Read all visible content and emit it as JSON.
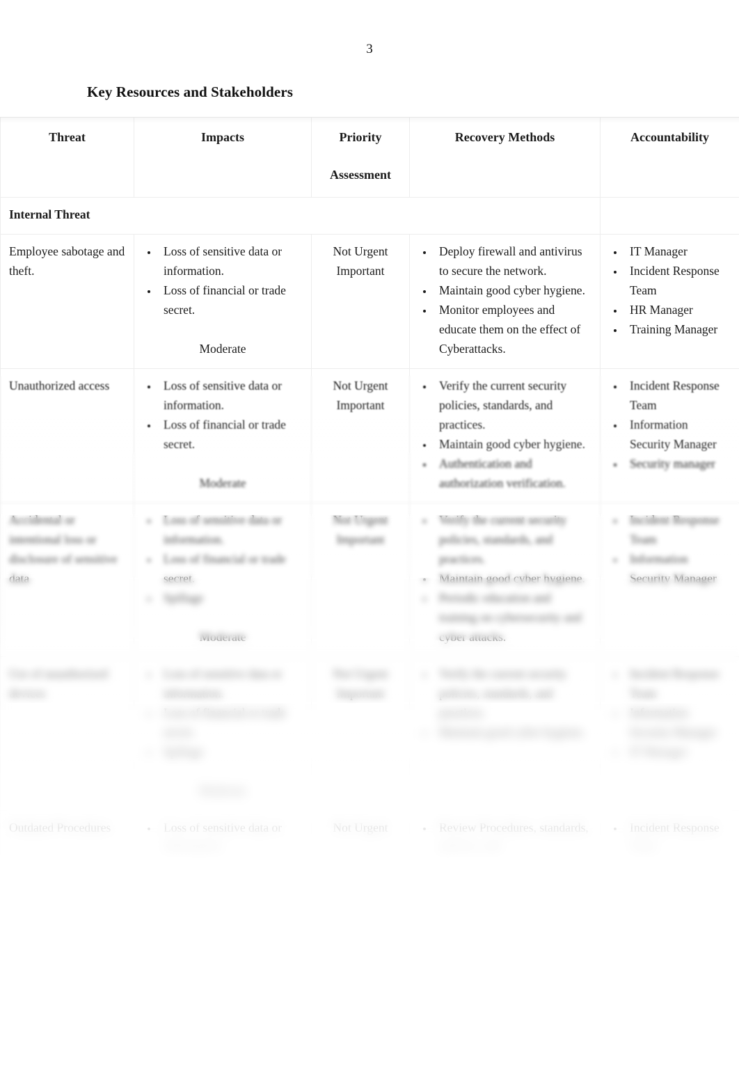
{
  "page": {
    "page_number": "3",
    "title": "Key Resources and Stakeholders"
  },
  "table": {
    "headers": {
      "threat": "Threat",
      "impacts": "Impacts",
      "priority_line1": "Priority",
      "priority_line2": "Assessment",
      "recovery": "Recovery Methods",
      "accountability": "Accountability"
    },
    "groups": [
      {
        "label": "Internal Threat",
        "rows": [
          {
            "threat": "Employee sabotage and theft.",
            "impacts": [
              "Loss of sensitive data or information.",
              "Loss of financial or trade secret."
            ],
            "impact_note": "Moderate",
            "priority": "Not Urgent Important",
            "recovery": [
              "Deploy firewall and antivirus to secure the network.",
              "Maintain good cyber hygiene.",
              "Monitor employees and educate them on the effect of Cyberattacks."
            ],
            "accountability": [
              "IT Manager",
              "Incident Response Team",
              "HR Manager",
              "Training Manager"
            ]
          },
          {
            "threat": "Unauthorized access",
            "impacts": [
              "Loss of sensitive data or information.",
              "Loss of financial or trade secret."
            ],
            "impact_note": "Moderate",
            "priority": "Not Urgent Important",
            "recovery": [
              "Verify the current security policies, standards, and practices.",
              "Maintain good cyber hygiene.",
              "Authentication and authorization verification."
            ],
            "accountability": [
              "Incident Response Team",
              "Information Security Manager",
              "Security manager"
            ]
          },
          {
            "threat": "Accidental or intentional loss or disclosure of sensitive data",
            "impacts": [
              "Loss of sensitive data or information.",
              "Loss of financial or trade secret.",
              "Spillage"
            ],
            "impact_note": "Moderate",
            "priority": "Not Urgent Important",
            "recovery": [
              "Verify the current security policies, standards, and practices.",
              "Maintain good cyber hygiene.",
              "Periodic education and training on cybersecurity and cyber attacks."
            ],
            "accountability": [
              "Incident Response Team",
              "Information Security Manager"
            ]
          },
          {
            "threat": "Use of unauthorized devices",
            "impacts": [
              "Loss of sensitive data or information.",
              "Loss of financial or trade secret.",
              "Spillage"
            ],
            "impact_note": "Moderate",
            "priority": "Not Urgent Important",
            "recovery": [
              "Verify the current security policies, standards, and practices.",
              "Maintain good cyber hygiene."
            ],
            "accountability": [
              "Incident Response Team",
              "Information Security Manager",
              "IT Manager"
            ]
          },
          {
            "threat": "Outdated Procedures",
            "impacts": [
              "Loss of sensitive data or information."
            ],
            "impact_note": "",
            "priority": "Not Urgent",
            "recovery": [
              "Review Procedures, standards, policies, and"
            ],
            "accountability": [
              "Incident Response Team"
            ]
          }
        ]
      }
    ]
  }
}
